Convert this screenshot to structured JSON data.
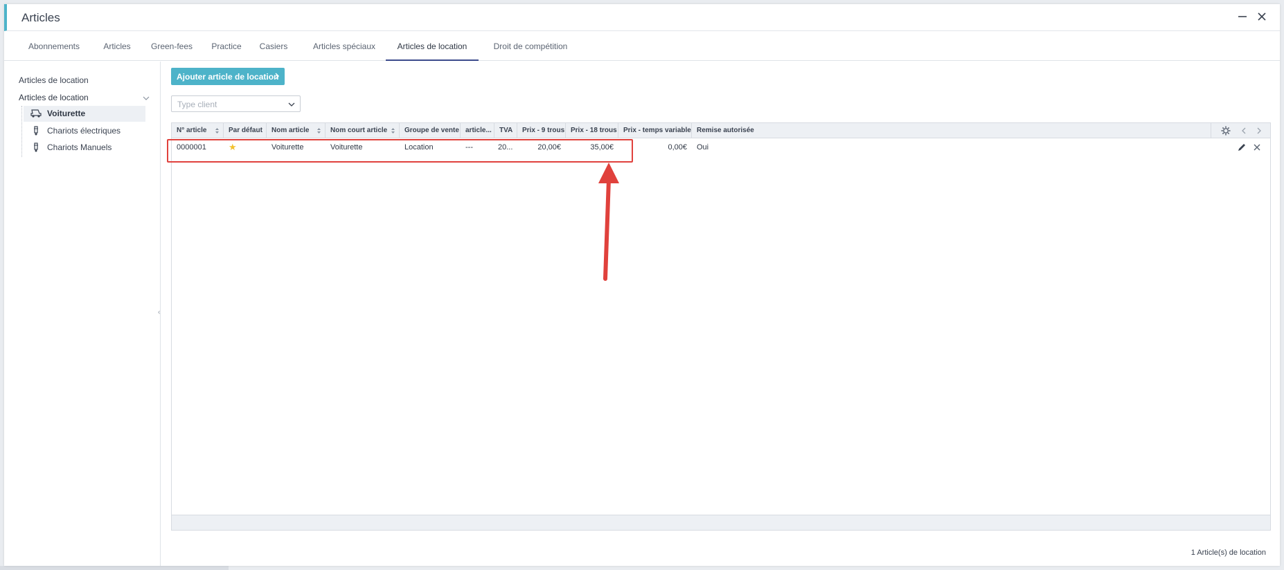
{
  "window": {
    "title": "Articles",
    "minimize_icon": "minimize-icon",
    "close_icon": "close-icon"
  },
  "tabs": [
    {
      "label": "Abonnements"
    },
    {
      "label": "Articles"
    },
    {
      "label": "Green-fees"
    },
    {
      "label": "Practice"
    },
    {
      "label": "Casiers"
    },
    {
      "label": "Articles spéciaux"
    },
    {
      "label": "Articles de location",
      "active": true
    },
    {
      "label": "Droit de compétition"
    }
  ],
  "sidebar": {
    "link": "Articles de location",
    "group": "Articles de location",
    "items": [
      {
        "label": "Voiturette",
        "icon": "golf-cart-icon",
        "selected": true
      },
      {
        "label": "Chariots électriques",
        "icon": "trolley-icon"
      },
      {
        "label": "Chariots Manuels",
        "icon": "trolley-icon"
      }
    ]
  },
  "toolbar": {
    "add_label": "Ajouter article de location",
    "filter_placeholder": "Type client"
  },
  "grid": {
    "columns": [
      {
        "label": "N° article",
        "sortable": true
      },
      {
        "label": "Par défaut"
      },
      {
        "label": "Nom article",
        "sortable": true
      },
      {
        "label": "Nom court article",
        "sortable": true
      },
      {
        "label": "Groupe de vente"
      },
      {
        "label": "article..."
      },
      {
        "label": "TVA"
      },
      {
        "label": "Prix - 9 trous"
      },
      {
        "label": "Prix - 18 trous"
      },
      {
        "label": "Prix - temps variable"
      },
      {
        "label": "Remise autorisée"
      }
    ],
    "rows": [
      {
        "numero": "0000001",
        "par_defaut": "★",
        "nom": "Voiturette",
        "nom_court": "Voiturette",
        "groupe": "Location",
        "article": "---",
        "tva": "20...",
        "prix_9": "20,00€",
        "prix_18": "35,00€",
        "prix_variable": "0,00€",
        "remise": "Oui"
      }
    ]
  },
  "footer": {
    "count": "1 Article(s) de location"
  },
  "colors": {
    "accent": "#4db3c9",
    "annotation": "#e0413c",
    "star": "#f2c12e"
  }
}
